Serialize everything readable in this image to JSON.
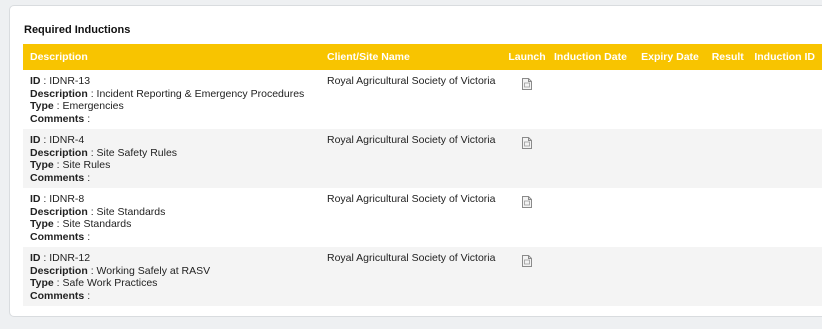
{
  "section": {
    "title": "Required Inductions"
  },
  "table": {
    "headers": {
      "description": "Description",
      "client": "Client/Site Name",
      "launch": "Launch",
      "induction_date": "Induction Date",
      "expiry_date": "Expiry Date",
      "result": "Result",
      "induction_id": "Induction ID"
    },
    "field_labels": {
      "id": "ID",
      "description": "Description",
      "type": "Type",
      "comments": "Comments"
    },
    "rows": [
      {
        "id": ": IDNR-13",
        "description": ": Incident Reporting & Emergency Procedures",
        "type": ": Emergencies",
        "comments": ":",
        "client": "Royal Agricultural Society of Victoria",
        "launch_icon": "document-icon",
        "induction_date": "",
        "expiry_date": "",
        "result": "",
        "induction_id": ""
      },
      {
        "id": ": IDNR-4",
        "description": ": Site Safety Rules",
        "type": ": Site Rules",
        "comments": ":",
        "client": "Royal Agricultural Society of Victoria",
        "launch_icon": "document-icon",
        "induction_date": "",
        "expiry_date": "",
        "result": "",
        "induction_id": ""
      },
      {
        "id": ": IDNR-8",
        "description": ": Site Standards",
        "type": ": Site Standards",
        "comments": ":",
        "client": "Royal Agricultural Society of Victoria",
        "launch_icon": "document-icon",
        "induction_date": "",
        "expiry_date": "",
        "result": "",
        "induction_id": ""
      },
      {
        "id": ": IDNR-12",
        "description": ": Working Safely at RASV",
        "type": ": Safe Work Practices",
        "comments": ":",
        "client": "Royal Agricultural Society of Victoria",
        "launch_icon": "document-icon",
        "induction_date": "",
        "expiry_date": "",
        "result": "",
        "induction_id": ""
      }
    ]
  },
  "colors": {
    "header_bg": "#f8c400",
    "header_text": "#ffffff",
    "row_alt_bg": "#f4f4f4"
  }
}
